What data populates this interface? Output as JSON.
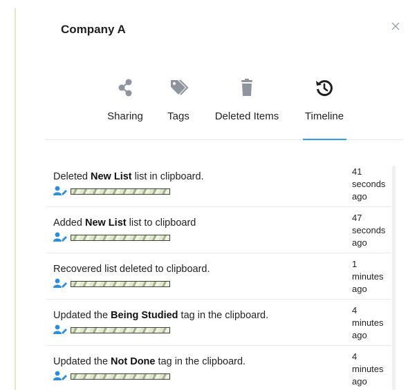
{
  "panel": {
    "title": "Company A"
  },
  "tabs": [
    {
      "label": "Sharing",
      "icon": "share-icon"
    },
    {
      "label": "Tags",
      "icon": "tags-icon"
    },
    {
      "label": "Deleted Items",
      "icon": "trash-icon"
    },
    {
      "label": "Timeline",
      "icon": "history-icon",
      "active": true
    }
  ],
  "timeline": [
    {
      "prefix": "Deleted ",
      "bold": "New List",
      "suffix": " list in clipboard.",
      "time": [
        "41",
        "seconds",
        "ago"
      ]
    },
    {
      "prefix": "Added ",
      "bold": "New List",
      "suffix": " list to clipboard",
      "time": [
        "47",
        "seconds",
        "ago"
      ]
    },
    {
      "prefix": "Recovered list deleted to clipboard.",
      "bold": "",
      "suffix": "",
      "time": [
        "1",
        "minutes",
        "ago"
      ]
    },
    {
      "prefix": "Updated the ",
      "bold": "Being Studied",
      "suffix": " tag in the clipboard.",
      "time": [
        "4",
        "minutes",
        "ago"
      ]
    },
    {
      "prefix": "Updated the ",
      "bold": "Not Done",
      "suffix": " tag in the clipboard.",
      "time": [
        "4",
        "minutes",
        "ago"
      ]
    }
  ],
  "colors": {
    "accent": "#2a9df4",
    "icon_muted": "#8f959e",
    "user_icon": "#2a8ee0"
  }
}
